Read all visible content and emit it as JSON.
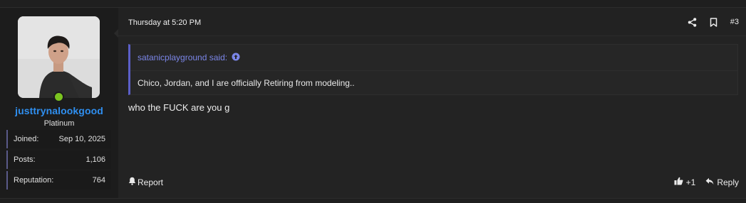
{
  "user": {
    "username": "justtrynalookgood",
    "title": "Platinum",
    "online": true,
    "stats": [
      {
        "label": "Joined:",
        "value": "Sep 10, 2025"
      },
      {
        "label": "Posts:",
        "value": "1,106"
      },
      {
        "label": "Reputation:",
        "value": "764"
      }
    ]
  },
  "post": {
    "date": "Thursday at 5:20 PM",
    "number": "#3",
    "quote": {
      "author_line": "satanicplayground said:",
      "text": "Chico, Jordan, and I are officially Retiring from modeling.."
    },
    "message": "who the FUCK are you g",
    "footer": {
      "report_label": "Report",
      "react_label": "+1",
      "reply_label": "Reply"
    }
  },
  "colors": {
    "username": "#2f8ff0",
    "online_dot": "#7bc420",
    "quote_accent": "#5b5fc7",
    "quote_link": "#7b86e8"
  },
  "icons": [
    "share-icon",
    "bookmark-icon",
    "arrow-up-circle-icon",
    "bell-icon",
    "thumbs-up-icon",
    "reply-arrow-icon"
  ]
}
